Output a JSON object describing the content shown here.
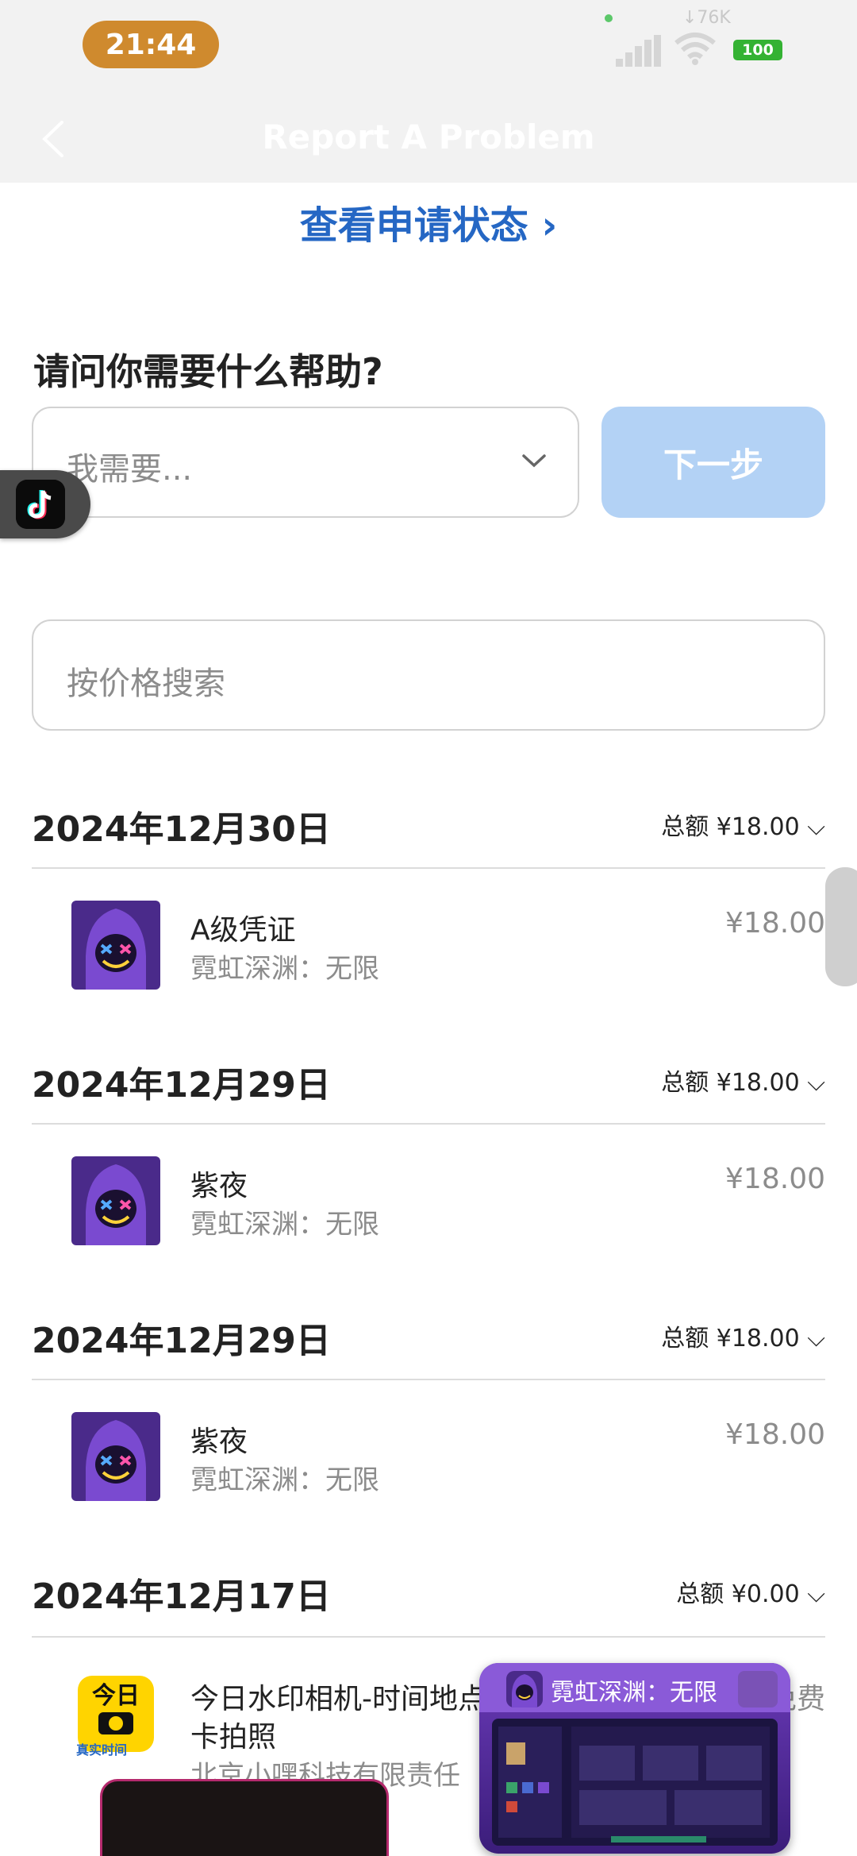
{
  "status_bar": {
    "time": "21:44",
    "net_speed": "↓76K",
    "battery": "100"
  },
  "nav": {
    "title": "Report A Problem"
  },
  "status_link": "查看申请状态 ›",
  "question": "请问你需要什么帮助?",
  "need_select": {
    "placeholder": "我需要..."
  },
  "next_button": "下一步",
  "search": {
    "placeholder": "按价格搜索"
  },
  "groups": [
    {
      "date": "2024年12月30日",
      "total": "总额 ¥18.00 ⌵",
      "item": {
        "name": "A级凭证",
        "sub": "霓虹深渊：无限",
        "price": "¥18.00"
      }
    },
    {
      "date": "2024年12月29日",
      "total": "总额 ¥18.00 ⌵",
      "item": {
        "name": "紫夜",
        "sub": "霓虹深渊：无限",
        "price": "¥18.00"
      }
    },
    {
      "date": "2024年12月29日",
      "total": "总额 ¥18.00 ⌵",
      "item": {
        "name": "紫夜",
        "sub": "霓虹深渊：无限",
        "price": "¥18.00"
      }
    },
    {
      "date": "2024年12月17日",
      "total": "总额 ¥0.00 ⌵",
      "item": {
        "name": "今日水印相机-时间地点",
        "name2": "卡拍照",
        "sub": "北京小嘿科技有限责任",
        "price": "免费"
      }
    }
  ],
  "jinri_icon": {
    "text": "今日",
    "caption": "真实时间"
  },
  "float_window": {
    "title": "霓虹深渊：无限"
  },
  "colors": {
    "accent": "#2567c4",
    "next_button_disabled": "#b3d2f5",
    "time_pill": "#cf8a2e",
    "battery": "#34b233"
  }
}
